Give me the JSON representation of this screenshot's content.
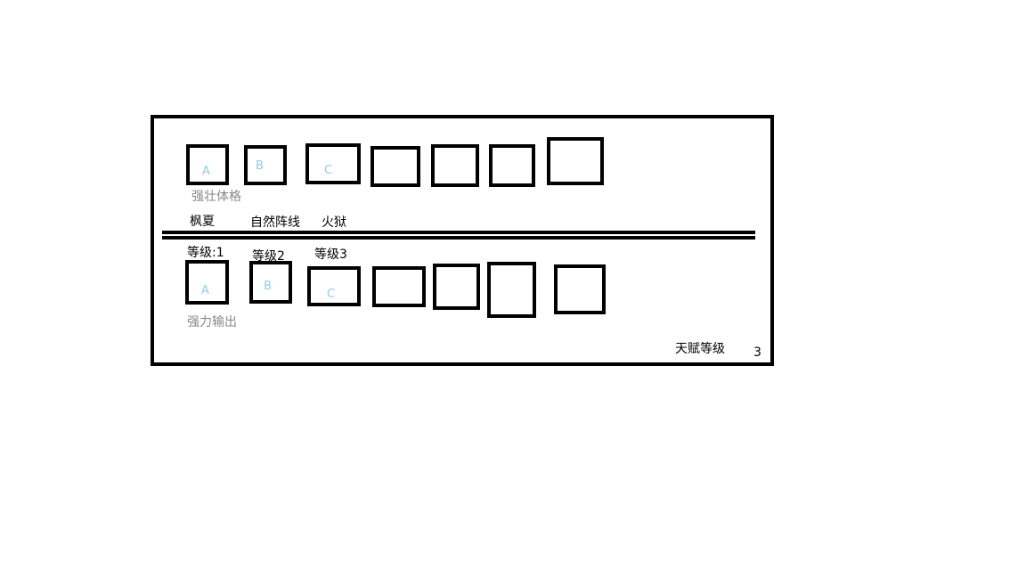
{
  "top_row": {
    "slots": [
      {
        "letter": "A"
      },
      {
        "letter": "B"
      },
      {
        "letter": "C"
      },
      {
        "letter": ""
      },
      {
        "letter": ""
      },
      {
        "letter": ""
      },
      {
        "letter": ""
      }
    ],
    "caption": "强壮体格"
  },
  "mid_labels": {
    "name": "枫夏",
    "branch_1": "自然阵线",
    "branch_2": "火狱"
  },
  "levels": {
    "level_1": "等级:1",
    "level_2": "等级2",
    "level_3": "等级3"
  },
  "bottom_row": {
    "slots": [
      {
        "letter": "A"
      },
      {
        "letter": "B"
      },
      {
        "letter": "C"
      },
      {
        "letter": ""
      },
      {
        "letter": ""
      },
      {
        "letter": ""
      },
      {
        "letter": ""
      }
    ],
    "caption": "强力输出"
  },
  "talent": {
    "label": "天赋等级",
    "value": "3"
  },
  "colors": {
    "letter": "#8ecfe6",
    "caption": "#888888",
    "border": "#000000"
  }
}
